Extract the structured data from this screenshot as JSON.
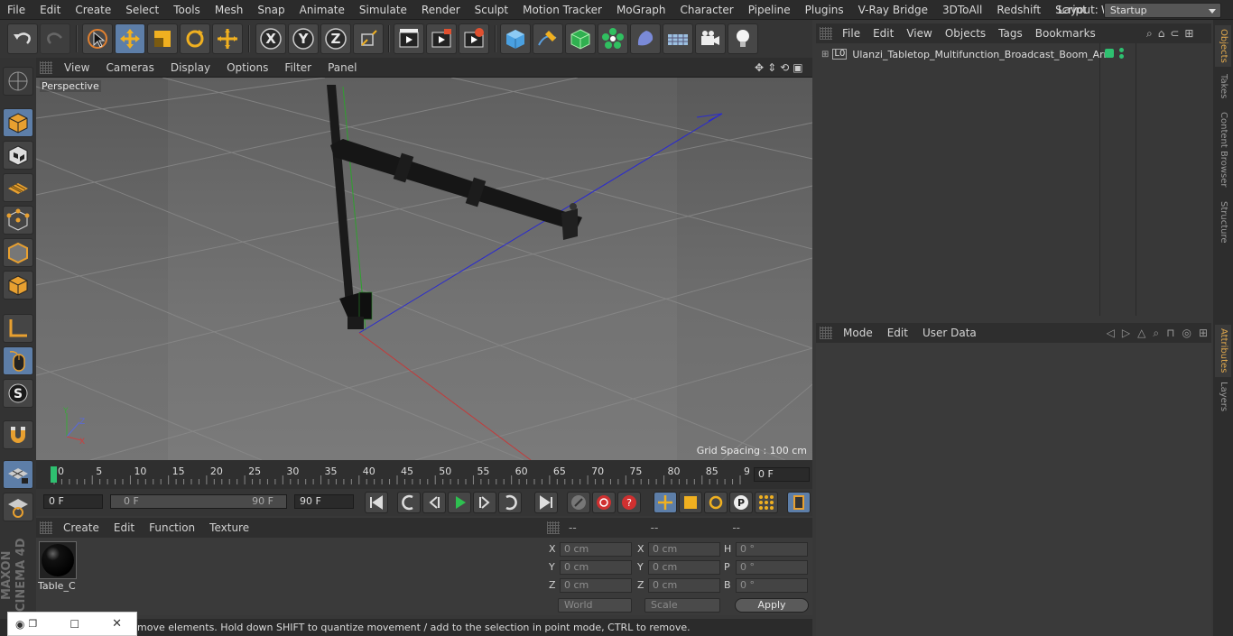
{
  "menubar": {
    "items": [
      "File",
      "Edit",
      "Create",
      "Select",
      "Tools",
      "Mesh",
      "Snap",
      "Animate",
      "Simulate",
      "Render",
      "Sculpt",
      "Motion Tracker",
      "MoGraph",
      "Character",
      "Pipeline",
      "Plugins",
      "V-Ray Bridge",
      "3DToAll",
      "Redshift",
      "Script",
      "Window",
      "Help"
    ],
    "layout_label": "Layout:",
    "layout_value": "Startup"
  },
  "toolbar": {
    "icons": [
      "undo-icon",
      "redo-icon",
      "live-selection-icon",
      "move-icon",
      "scale-icon",
      "rotate-icon",
      "recent-tool-icon",
      "x-axis-icon",
      "y-axis-icon",
      "z-axis-icon",
      "coordinate-system-icon",
      "render-view-icon",
      "render-picture-viewer-icon",
      "render-settings-icon",
      "cube-icon",
      "pen-spline-icon",
      "subdivision-icon",
      "cloner-icon",
      "deformer-icon",
      "floor-icon",
      "camera-icon",
      "light-icon"
    ]
  },
  "axis_labels": {
    "x": "X",
    "y": "Y",
    "z": "Z"
  },
  "viewport": {
    "menu": [
      "View",
      "Cameras",
      "Display",
      "Options",
      "Filter",
      "Panel"
    ],
    "label": "Perspective",
    "grid_spacing": "Grid Spacing : 100 cm"
  },
  "timeline": {
    "ticks": [
      "0",
      "5",
      "10",
      "15",
      "20",
      "25",
      "30",
      "35",
      "40",
      "45",
      "50",
      "55",
      "60",
      "65",
      "70",
      "75",
      "80",
      "85",
      "90"
    ],
    "current_frame": "0 F",
    "start_field": "0 F",
    "range_start": "0 F",
    "range_end": "90 F",
    "end_field": "90 F"
  },
  "materials": {
    "menu": [
      "Create",
      "Edit",
      "Function",
      "Texture"
    ],
    "items": [
      {
        "name": "Table_C"
      }
    ]
  },
  "coordinates": {
    "headers": [
      "--",
      "--",
      "--"
    ],
    "rows": [
      {
        "a": "X",
        "av": "0 cm",
        "b": "X",
        "bv": "0 cm",
        "c": "H",
        "cv": "0 °"
      },
      {
        "a": "Y",
        "av": "0 cm",
        "b": "Y",
        "bv": "0 cm",
        "c": "P",
        "cv": "0 °"
      },
      {
        "a": "Z",
        "av": "0 cm",
        "b": "Z",
        "bv": "0 cm",
        "c": "B",
        "cv": "0 °"
      }
    ],
    "mode1": "World",
    "mode2": "Scale",
    "apply": "Apply"
  },
  "objects": {
    "menu": [
      "File",
      "Edit",
      "View",
      "Objects",
      "Tags",
      "Bookmarks"
    ],
    "items": [
      {
        "name": "Ulanzi_Tabletop_Multifunction_Broadcast_Boom_Arm"
      }
    ]
  },
  "attributes": {
    "menu": [
      "Mode",
      "Edit",
      "User Data"
    ]
  },
  "sidetabs": {
    "top": [
      "Objects",
      "Takes",
      "Content Browser",
      "Structure"
    ],
    "bottom": [
      "Attributes",
      "Layers"
    ]
  },
  "brand": "MAXON CINEMA 4D",
  "status": "move elements. Hold down SHIFT to quantize movement / add to the selection in point mode, CTRL to remove.",
  "colors": {
    "accent": "#5d7ea8",
    "x_axis": "#c84040",
    "y_axis": "#3aa83a",
    "z_axis": "#3a3ad0",
    "highlight": "#e0a84d"
  }
}
